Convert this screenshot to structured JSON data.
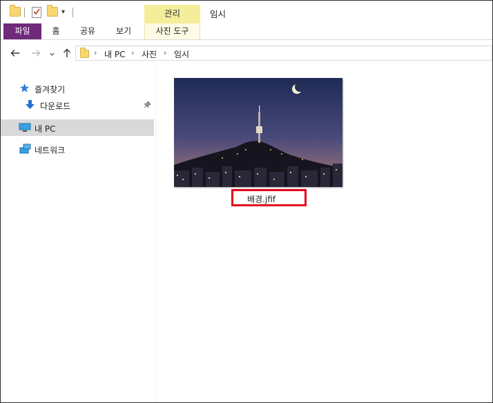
{
  "ribbon": {
    "context_group": "관리",
    "window_title": "임시",
    "tabs": [
      {
        "label": "파일"
      },
      {
        "label": "홈"
      },
      {
        "label": "공유"
      },
      {
        "label": "보기"
      },
      {
        "label": "사진 도구"
      }
    ],
    "colors": {
      "file_tab": "#6f2a7a",
      "context": "#f4ee9b"
    }
  },
  "address": {
    "crumbs": [
      "내 PC",
      "사진",
      "임시"
    ]
  },
  "nav": {
    "items": [
      {
        "label": "즐겨찾기",
        "icon": "star-icon"
      },
      {
        "label": "다운로드",
        "icon": "download-icon",
        "pinned": true
      },
      {
        "label": "내 PC",
        "icon": "pc-icon",
        "selected": true
      },
      {
        "label": "네트워크",
        "icon": "network-icon"
      }
    ]
  },
  "content": {
    "file": {
      "name": "배경.jfif",
      "highlight_color": "#e3001b"
    }
  }
}
